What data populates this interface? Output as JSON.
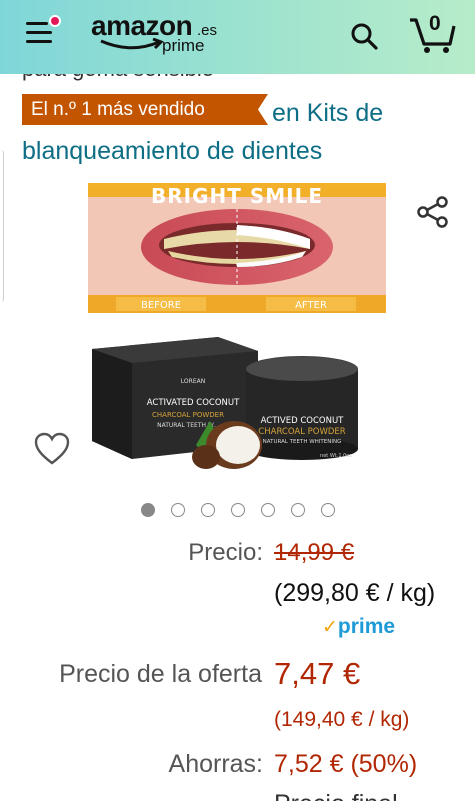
{
  "header": {
    "logo_word": "amazon",
    "logo_tld": ".es",
    "logo_sub": "prime",
    "cart_count": "0",
    "colors": {
      "gradient_start": "#7fd6d8",
      "gradient_end": "#b7ecc9",
      "notification": "#e3185b"
    }
  },
  "product": {
    "cutoff_text": "para goma sensible",
    "bestseller_badge": "El n.º 1 más vendido",
    "bestseller_category": "en Kits de blanqueamiento de dientes",
    "image": {
      "banner_text": "BRIGHT SMILE",
      "before_label": "BEFORE",
      "after_label": "AFTER",
      "box_title_1": "ACTIVATED COCONUT",
      "box_title_2": "CHARCOAL POWDER",
      "box_title_3": "NATURAL TEETH W...",
      "box_brand": "LOREAN",
      "jar_title_1": "ACTIVED COCONUT",
      "jar_title_2": "CHARCOAL POWDER",
      "jar_title_3": "NATURAL TEETH WHITENING",
      "jar_weight": "net Wt.1.0oz"
    },
    "carousel": {
      "count": 7,
      "active_index": 0
    }
  },
  "pricing": {
    "price_label": "Precio:",
    "list_price": "14,99 €",
    "list_unit_price": "(299,80 € / kg)",
    "prime_label": "prime",
    "offer_label": "Precio de la oferta",
    "offer_price": "7,47 €",
    "offer_unit_price": "(149,40 € / kg)",
    "savings_label": "Ahorras:",
    "savings_value": "7,52 € (50%)",
    "bottom_cutoff": "Precio final"
  },
  "colors": {
    "price_red": "#b12704",
    "link_teal": "#0d6e85",
    "badge_orange": "#c45500",
    "prime_blue": "#1e9bd7"
  }
}
